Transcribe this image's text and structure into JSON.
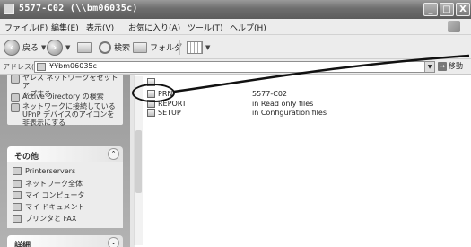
{
  "window": {
    "title": "5577-C02 (\\\\bm06035c)",
    "minimize": "_",
    "maximize": "□",
    "close": "X"
  },
  "menu": [
    "ファイル(F)",
    "編集(E)",
    "表示(V)",
    "お気に入り(A)",
    "ツール(T)",
    "ヘルプ(H)"
  ],
  "toolbar": {
    "back_label": "戻る",
    "search_label": "検索",
    "folders_label": "フォルダ"
  },
  "address": {
    "label": "アドレス(D)",
    "value": "¥¥bm06035c",
    "go_label": "移動"
  },
  "taskpane": {
    "top_tasks": [
      {
        "text": "ヤレス ネットワークをセットア\nップする",
        "icon": "wireless-icon"
      },
      {
        "text": "Active Directory の検索",
        "icon": "directory-search-icon"
      },
      {
        "text": "ネットワークに接続している\nUPnP デバイスのアイコンを\n非表示にする",
        "icon": "upnp-icon"
      }
    ],
    "other_places": {
      "title": "その他",
      "items": [
        {
          "label": "Printerservers",
          "icon": "printer-servers-icon"
        },
        {
          "label": "ネットワーク全体",
          "icon": "network-icon"
        },
        {
          "label": "マイ コンピュータ",
          "icon": "computer-icon"
        },
        {
          "label": "マイ ドキュメント",
          "icon": "documents-icon"
        },
        {
          "label": "プリンタと FAX",
          "icon": "printer-icon"
        }
      ]
    },
    "details": {
      "title": "詳細"
    }
  },
  "files": [
    {
      "name": "...",
      "description": "..."
    },
    {
      "name": "PRN",
      "description": "5577-C02"
    },
    {
      "name": "REPORT",
      "description": "in Read only files"
    },
    {
      "name": "SETUP",
      "description": "in Configuration files"
    }
  ]
}
